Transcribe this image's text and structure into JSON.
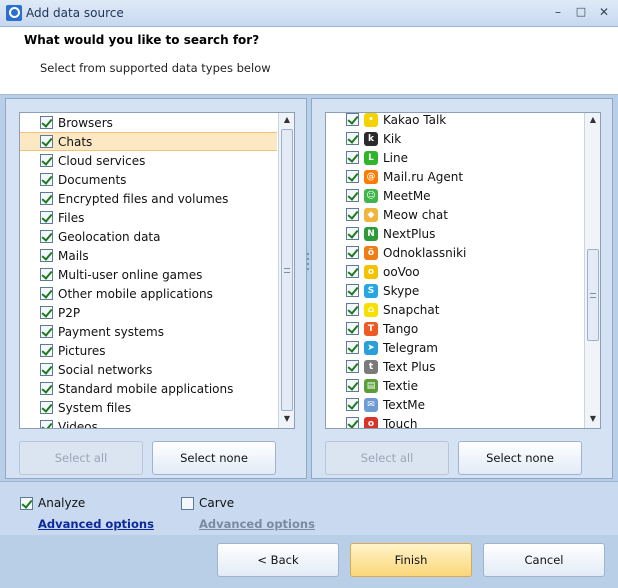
{
  "window": {
    "title": "Add data source",
    "minimize": "–",
    "maximize": "□",
    "close": "✕"
  },
  "header": {
    "title": "What would you like to search for?",
    "subtitle": "Select from supported data types below"
  },
  "left_list": {
    "items": [
      {
        "label": "Browsers",
        "checked": true
      },
      {
        "label": "Chats",
        "checked": true,
        "selected": true
      },
      {
        "label": "Cloud services",
        "checked": true
      },
      {
        "label": "Documents",
        "checked": true
      },
      {
        "label": "Encrypted files and volumes",
        "checked": true
      },
      {
        "label": "Files",
        "checked": true
      },
      {
        "label": "Geolocation data",
        "checked": true
      },
      {
        "label": "Mails",
        "checked": true
      },
      {
        "label": "Multi-user online games",
        "checked": true
      },
      {
        "label": "Other mobile applications",
        "checked": true
      },
      {
        "label": "P2P",
        "checked": true
      },
      {
        "label": "Payment systems",
        "checked": true
      },
      {
        "label": "Pictures",
        "checked": true
      },
      {
        "label": "Social networks",
        "checked": true
      },
      {
        "label": "Standard mobile applications",
        "checked": true
      },
      {
        "label": "System files",
        "checked": true
      },
      {
        "label": "Videos",
        "checked": true
      }
    ],
    "select_all": "Select all",
    "select_none": "Select none"
  },
  "right_list": {
    "items": [
      {
        "label": "Kakao Talk",
        "checked": true,
        "icon": "kakao-talk-icon",
        "color": "#f5d300",
        "glyph": "•"
      },
      {
        "label": "Kik",
        "checked": true,
        "icon": "kik-icon",
        "color": "#2b2b2b",
        "glyph": "k"
      },
      {
        "label": "Line",
        "checked": true,
        "icon": "line-icon",
        "color": "#2fb52a",
        "glyph": "L"
      },
      {
        "label": "Mail.ru Agent",
        "checked": true,
        "icon": "mailru-agent-icon",
        "color": "#ff7a00",
        "glyph": "@"
      },
      {
        "label": "MeetMe",
        "checked": true,
        "icon": "meetme-icon",
        "color": "#3fb54a",
        "glyph": "☺"
      },
      {
        "label": "Meow chat",
        "checked": true,
        "icon": "meow-chat-icon",
        "color": "#f0b53c",
        "glyph": "◆"
      },
      {
        "label": "NextPlus",
        "checked": true,
        "icon": "nextplus-icon",
        "color": "#2e9a3a",
        "glyph": "N"
      },
      {
        "label": "Odnoklassniki",
        "checked": true,
        "icon": "odnoklassniki-icon",
        "color": "#f07c16",
        "glyph": "ö"
      },
      {
        "label": "ooVoo",
        "checked": true,
        "icon": "oovoo-icon",
        "color": "#f5c200",
        "glyph": "o"
      },
      {
        "label": "Skype",
        "checked": true,
        "icon": "skype-icon",
        "color": "#26a6e3",
        "glyph": "S"
      },
      {
        "label": "Snapchat",
        "checked": true,
        "icon": "snapchat-icon",
        "color": "#f7e000",
        "glyph": "⌂"
      },
      {
        "label": "Tango",
        "checked": true,
        "icon": "tango-icon",
        "color": "#ee5a24",
        "glyph": "T"
      },
      {
        "label": "Telegram",
        "checked": true,
        "icon": "telegram-icon",
        "color": "#2a9fd8",
        "glyph": "➤"
      },
      {
        "label": "Text Plus",
        "checked": true,
        "icon": "textplus-icon",
        "color": "#7a7a7a",
        "glyph": "t"
      },
      {
        "label": "Textie",
        "checked": true,
        "icon": "textie-icon",
        "color": "#5a9e3a",
        "glyph": "▤"
      },
      {
        "label": "TextMe",
        "checked": true,
        "icon": "textme-icon",
        "color": "#6d9cd4",
        "glyph": "✉"
      },
      {
        "label": "Touch",
        "checked": true,
        "icon": "touch-icon",
        "color": "#d9342b",
        "glyph": "o"
      }
    ],
    "select_all": "Select all",
    "select_none": "Select none"
  },
  "options": {
    "analyze_label": "Analyze",
    "analyze_checked": true,
    "carve_label": "Carve",
    "carve_checked": false,
    "advanced_options_analyze": "Advanced options",
    "advanced_options_carve": "Advanced options"
  },
  "footer": {
    "back": "< Back",
    "finish": "Finish",
    "cancel": "Cancel"
  },
  "colors": {
    "accent": "#fbd67a",
    "link": "#0a2a9c",
    "link_disabled": "#7a8aa0"
  }
}
